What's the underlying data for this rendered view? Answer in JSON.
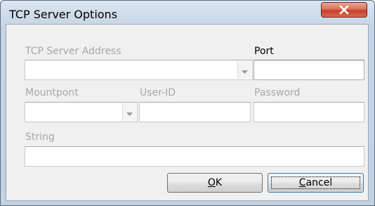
{
  "window": {
    "title": "TCP Server Options"
  },
  "form": {
    "tcp_server_address": {
      "label": "TCP Server Address",
      "value": ""
    },
    "port": {
      "label": "Port",
      "value": ""
    },
    "mountpoint": {
      "label": "Mountpont",
      "value": ""
    },
    "user_id": {
      "label": "User-ID",
      "value": ""
    },
    "password": {
      "label": "Password",
      "value": ""
    },
    "string": {
      "label": "String",
      "value": ""
    }
  },
  "buttons": {
    "ok": {
      "mnemonic": "O",
      "rest": "K"
    },
    "cancel": {
      "mnemonic": "C",
      "rest": "ancel"
    }
  },
  "icons": {
    "close": "close-icon",
    "dropdown": "chevron-down-icon"
  },
  "colors": {
    "disabled_text": "#a7a7a7",
    "close_button": "#c2412a",
    "dialog_background": "#f0f0f0"
  }
}
